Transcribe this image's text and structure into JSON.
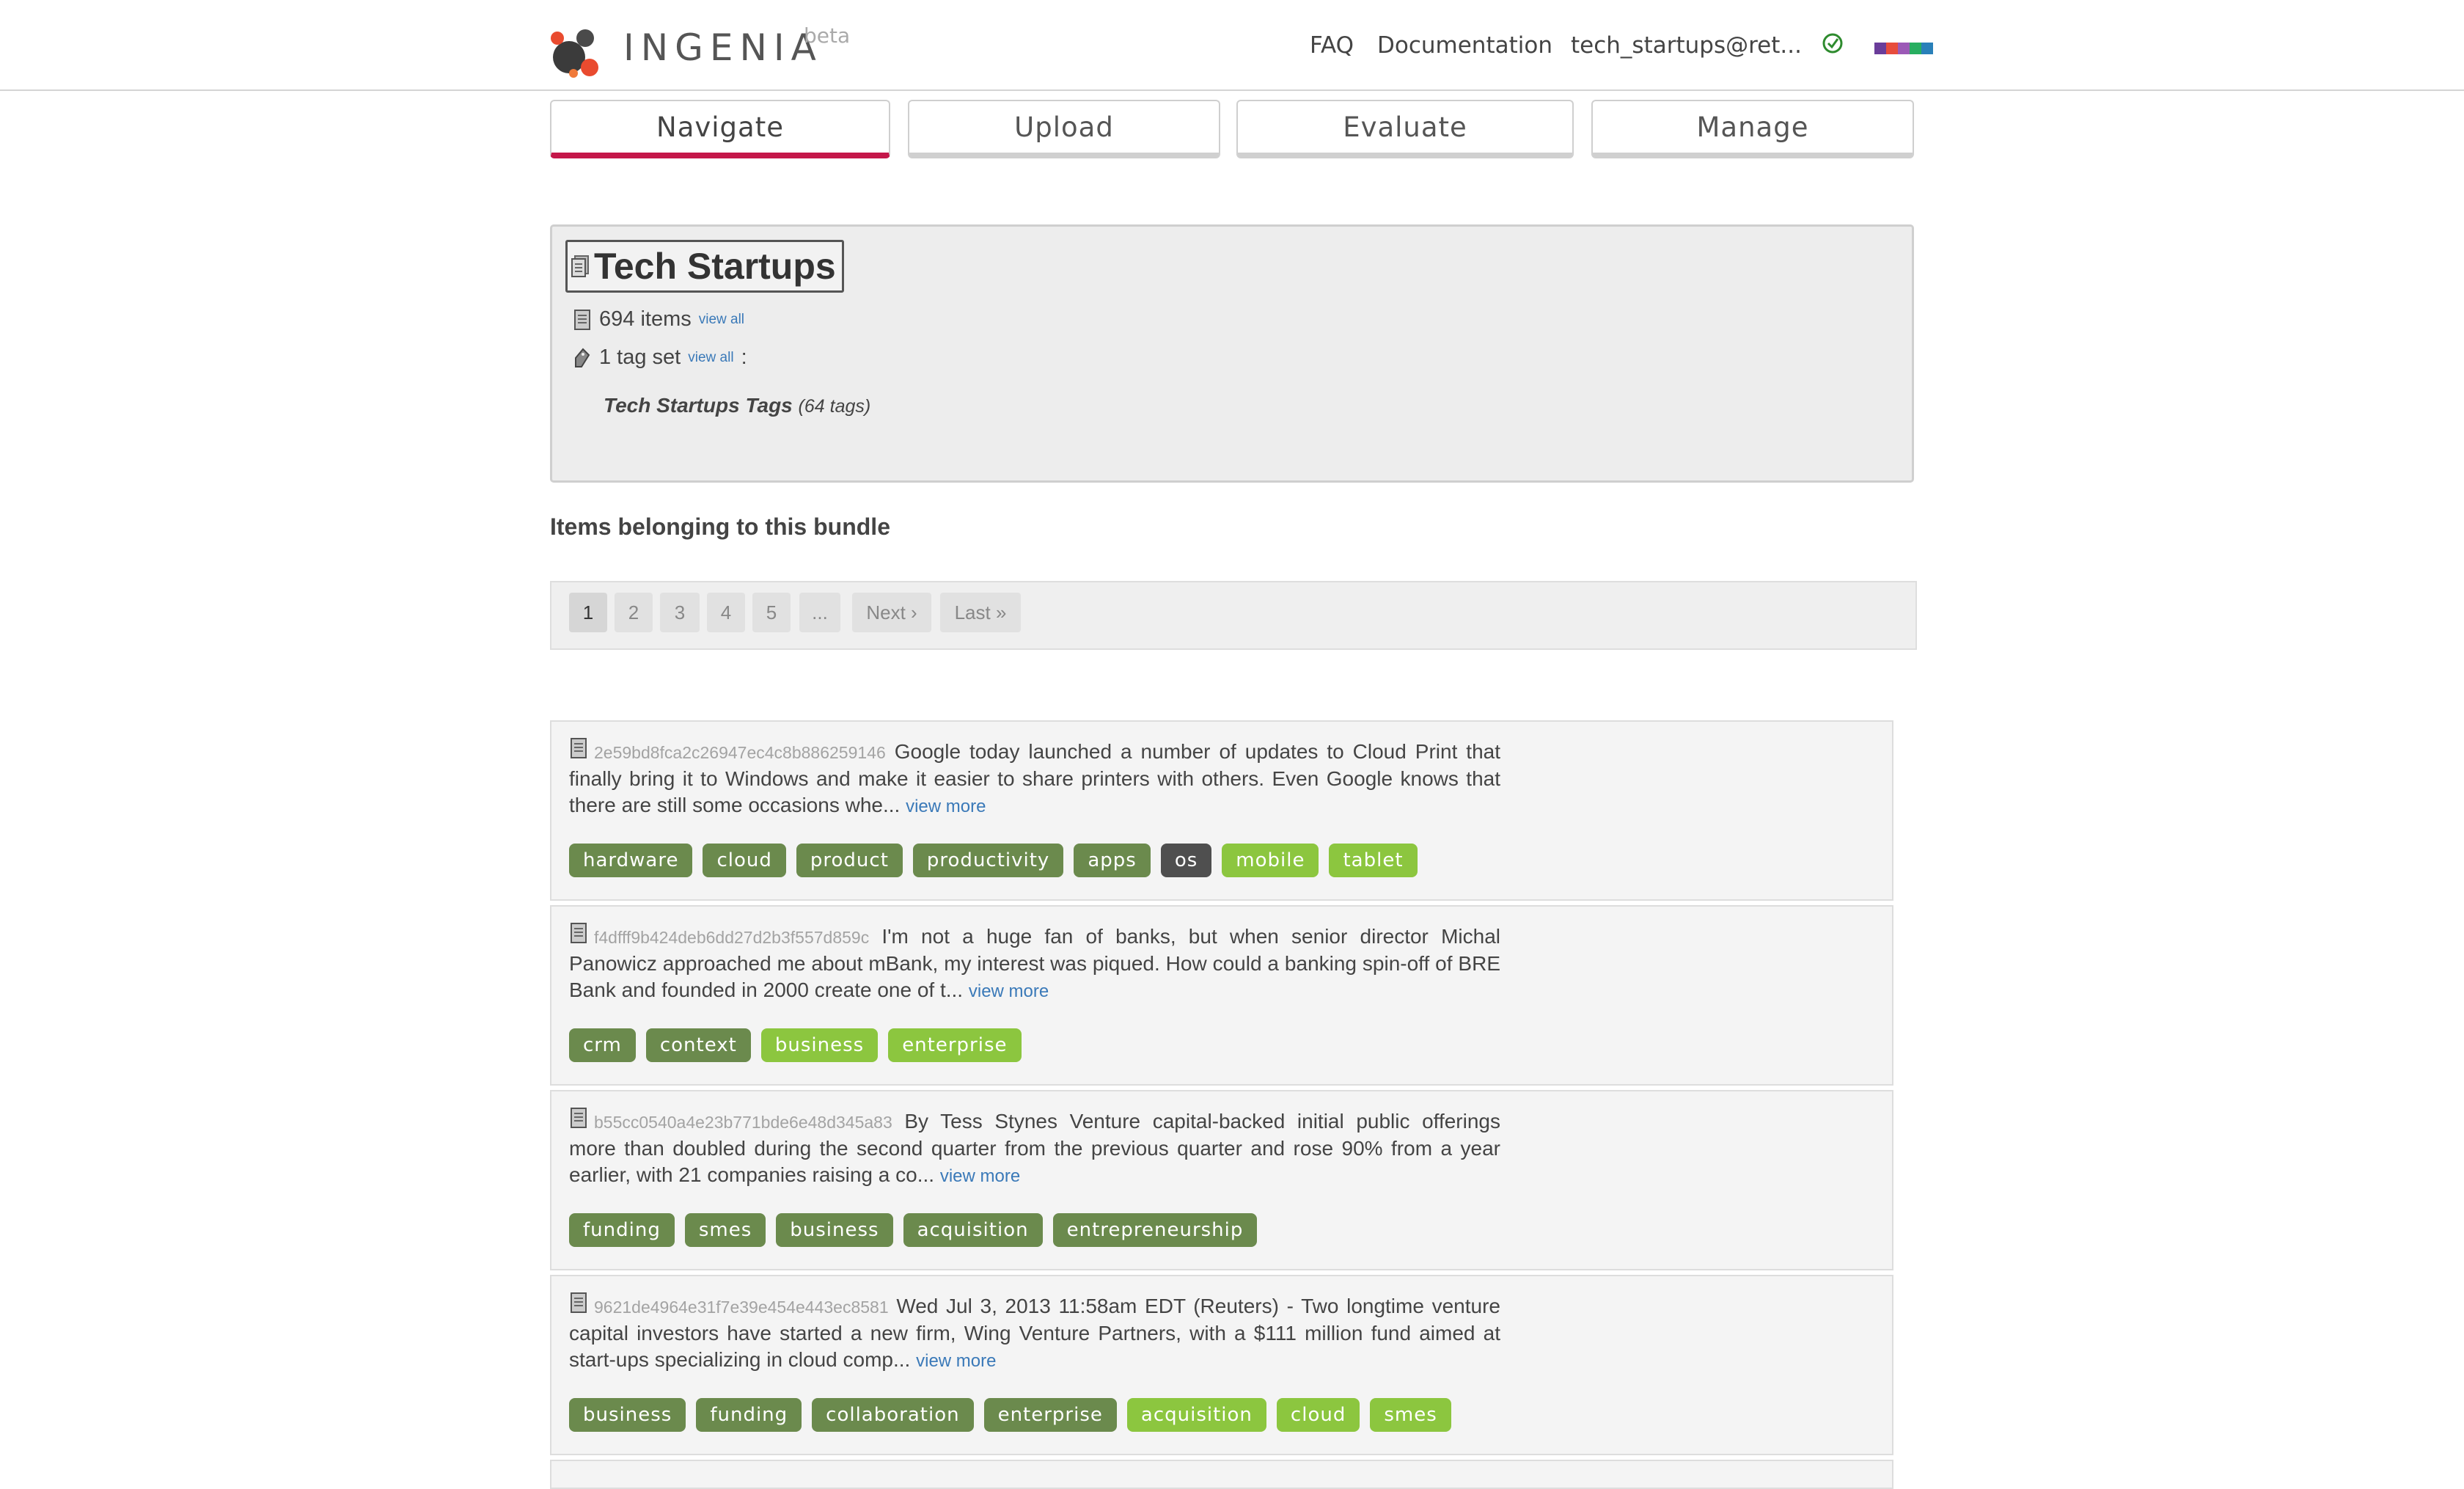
{
  "header": {
    "brand": "INGENIA",
    "beta": "beta",
    "links": [
      "FAQ",
      "Documentation",
      "tech_startups@ret..."
    ],
    "palette_colors": [
      "#6a3d9a",
      "#e74c3c",
      "#9b59b6",
      "#27ae60",
      "#2980b9"
    ]
  },
  "tabs": [
    {
      "label": "Navigate",
      "active": true
    },
    {
      "label": "Upload",
      "active": false
    },
    {
      "label": "Evaluate",
      "active": false
    },
    {
      "label": "Manage",
      "active": false
    }
  ],
  "bundle": {
    "title": "Tech Startups",
    "items_count": "694 items",
    "items_link": "view all",
    "tagsets_count": "1 tag set",
    "tagsets_link": "view all",
    "tagsets_colon": ":",
    "tagset_name": "Tech Startups Tags",
    "tagset_count": "(64 tags)"
  },
  "section_title": "Items belonging to this bundle",
  "pager": [
    "1",
    "2",
    "3",
    "4",
    "5",
    "...",
    "Next ›",
    "Last »"
  ],
  "items": [
    {
      "id": "2e59bd8fca2c26947ec4c8b886259146",
      "text": "Google today launched a number of updates to Cloud Print that finally bring it to Windows and make it easier to share printers with others. Even Google knows that there are still some occasions whe...",
      "more": "view more",
      "tags": [
        {
          "label": "hardware",
          "style": "dark"
        },
        {
          "label": "cloud",
          "style": "dark"
        },
        {
          "label": "product",
          "style": "dark"
        },
        {
          "label": "productivity",
          "style": "dark"
        },
        {
          "label": "apps",
          "style": "dark"
        },
        {
          "label": "os",
          "style": "black"
        },
        {
          "label": "mobile",
          "style": "light"
        },
        {
          "label": "tablet",
          "style": "light"
        }
      ]
    },
    {
      "id": "f4dfff9b424deb6dd27d2b3f557d859c",
      "text": "I'm not a huge fan of banks, but when senior director Michal Panowicz approached me about mBank, my interest was piqued. How could a banking spin-off of BRE Bank and founded in 2000 create one of t...",
      "more": "view more",
      "tags": [
        {
          "label": "crm",
          "style": "dark"
        },
        {
          "label": "context",
          "style": "dark"
        },
        {
          "label": "business",
          "style": "light"
        },
        {
          "label": "enterprise",
          "style": "light"
        }
      ]
    },
    {
      "id": "b55cc0540a4e23b771bde6e48d345a83",
      "text": "By Tess Stynes Venture capital-backed initial public offerings more than doubled during the second quarter from the previous quarter and rose 90% from a year earlier, with 21 companies raising a co...",
      "more": "view more",
      "tags": [
        {
          "label": "funding",
          "style": "dark"
        },
        {
          "label": "smes",
          "style": "dark"
        },
        {
          "label": "business",
          "style": "dark"
        },
        {
          "label": "acquisition",
          "style": "dark"
        },
        {
          "label": "entrepreneurship",
          "style": "dark"
        }
      ]
    },
    {
      "id": "9621de4964e31f7e39e454e443ec8581",
      "text": "Wed Jul 3, 2013 11:58am EDT (Reuters) - Two longtime venture capital investors have started a new firm, Wing Venture Partners, with a $111 million fund aimed at start-ups specializing in cloud comp...",
      "more": "view more",
      "tags": [
        {
          "label": "business",
          "style": "dark"
        },
        {
          "label": "funding",
          "style": "dark"
        },
        {
          "label": "collaboration",
          "style": "dark"
        },
        {
          "label": "enterprise",
          "style": "dark"
        },
        {
          "label": "acquisition",
          "style": "light"
        },
        {
          "label": "cloud",
          "style": "light"
        },
        {
          "label": "smes",
          "style": "light"
        }
      ]
    }
  ]
}
